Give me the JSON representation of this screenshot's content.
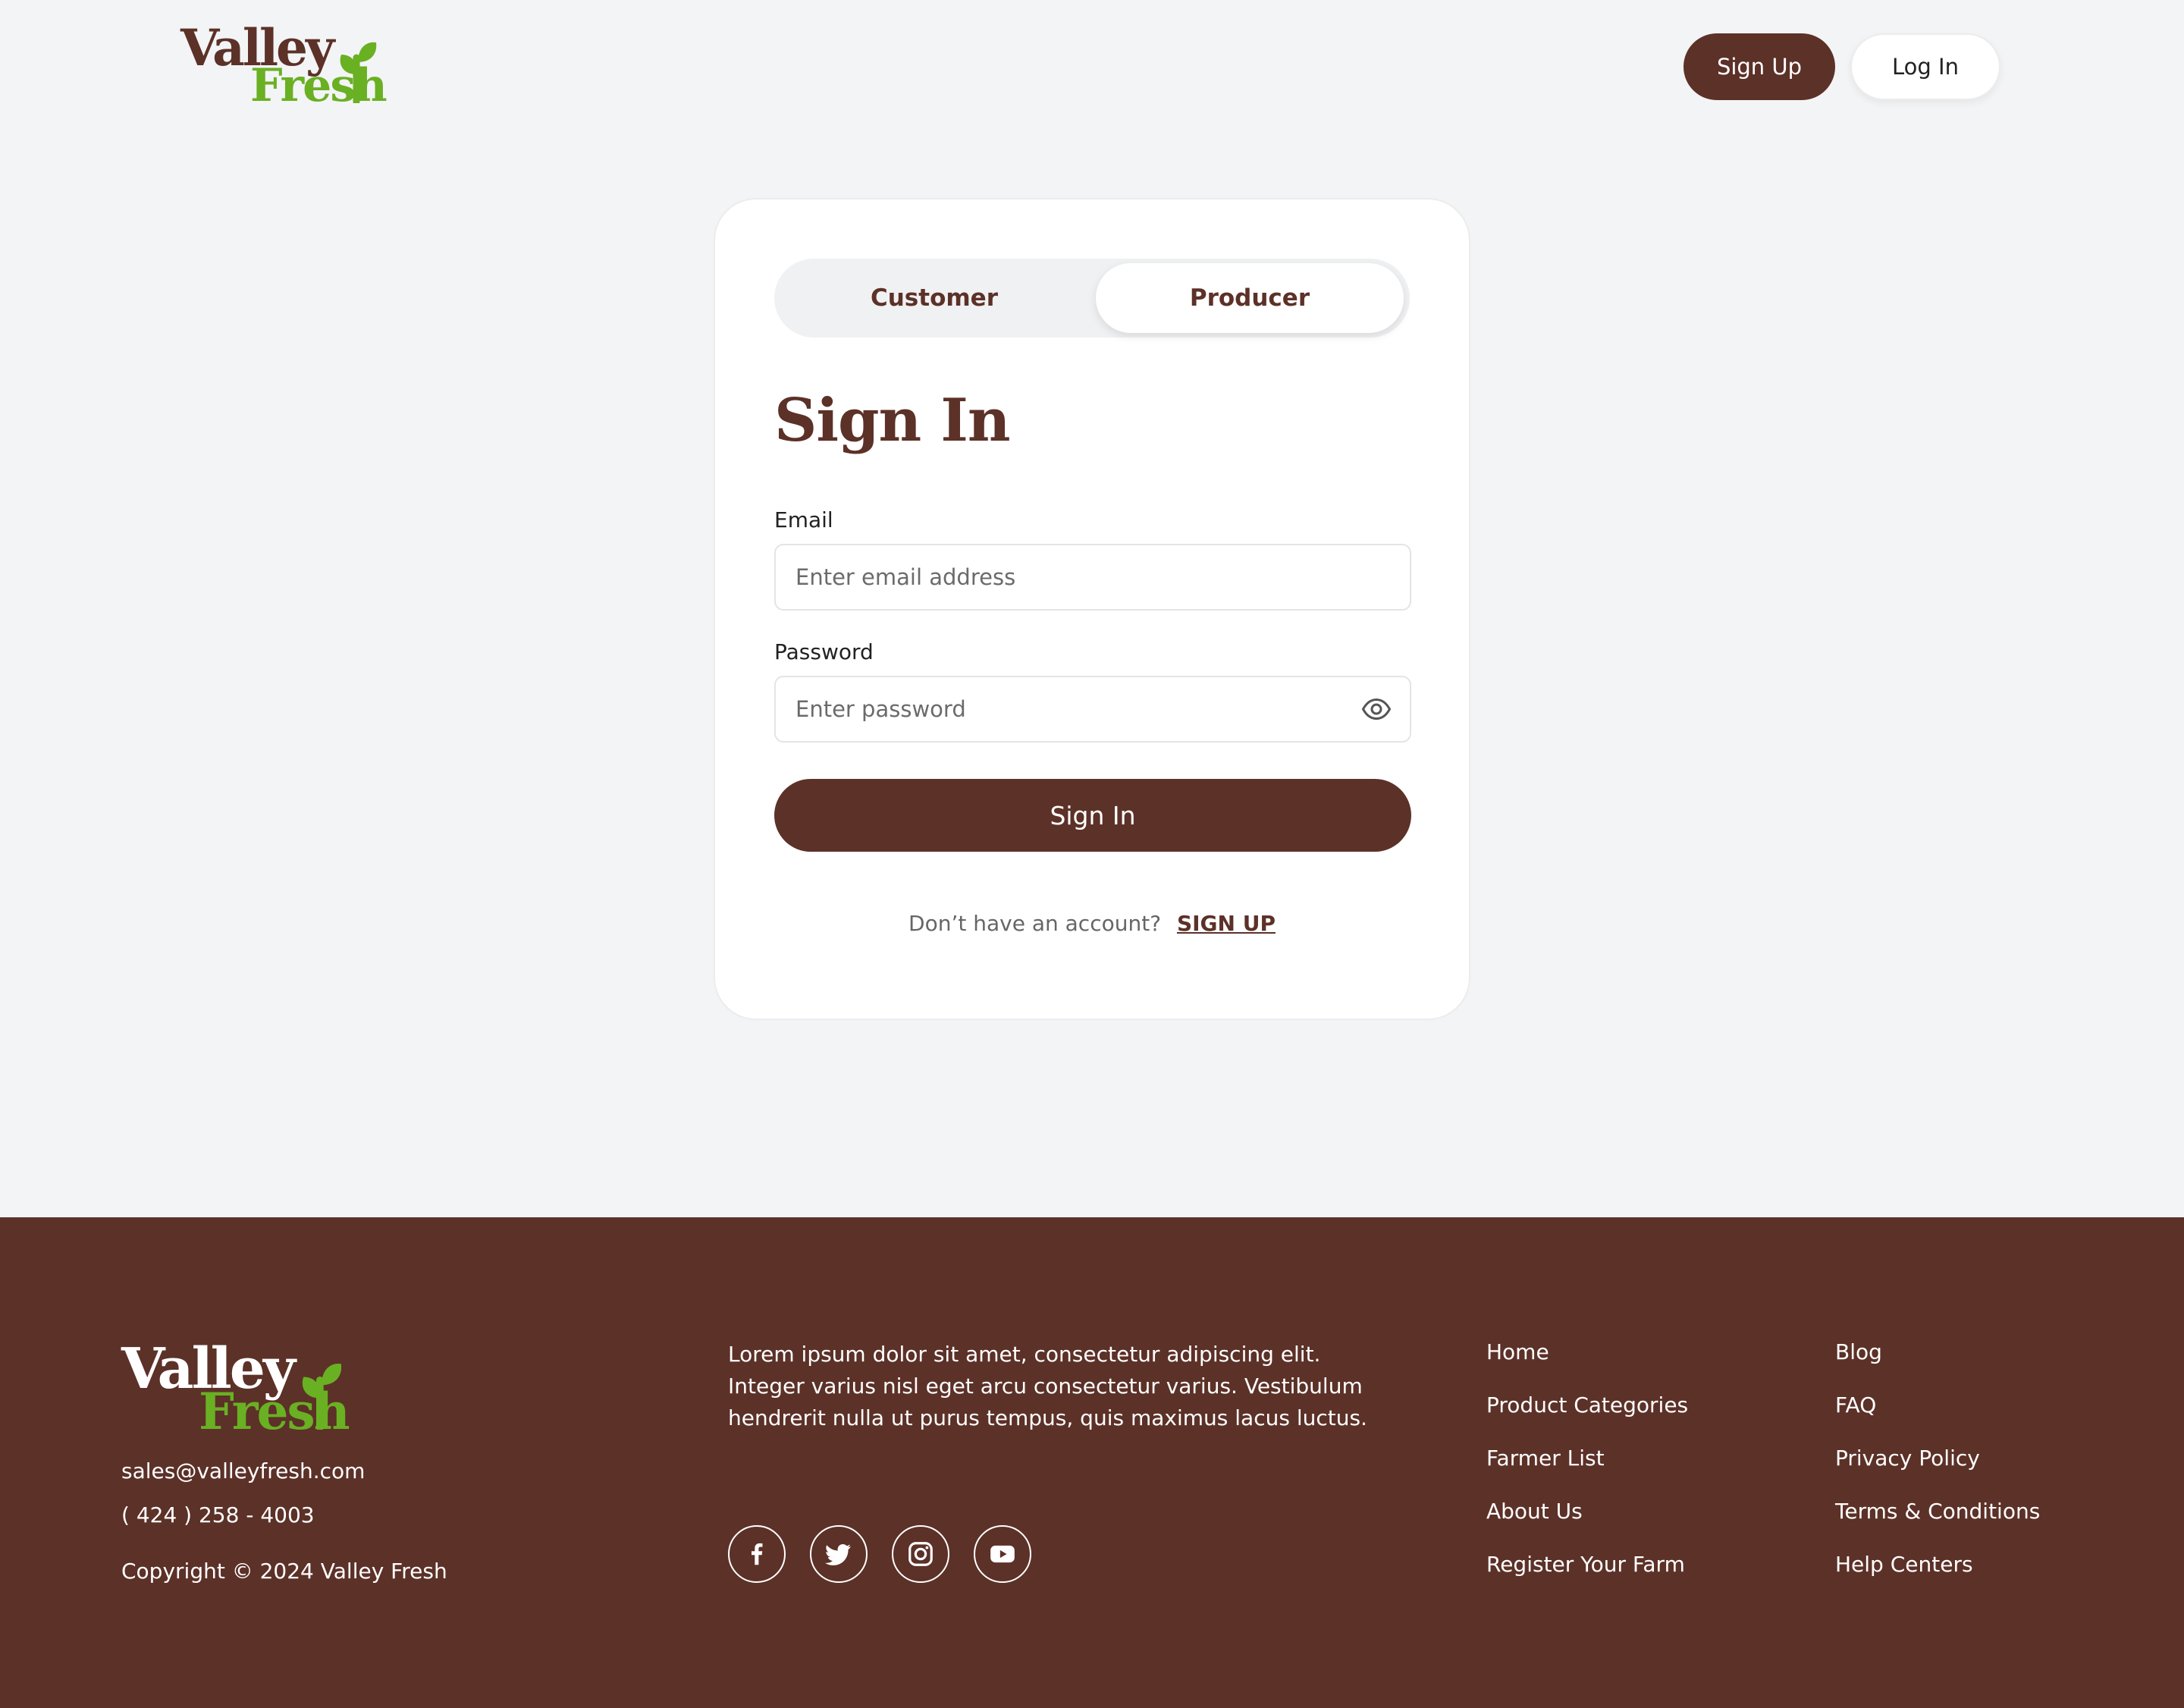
{
  "colors": {
    "brand_brown": "#5c3128",
    "brand_green": "#6ab023",
    "page_bg": "#f3f4f6",
    "card_bg": "#ffffff"
  },
  "logo": {
    "line1": "Valley",
    "line2": "Fresh",
    "icon": "sprout-icon"
  },
  "header": {
    "signup_label": "Sign Up",
    "login_label": "Log In"
  },
  "auth": {
    "tabs": [
      {
        "label": "Customer",
        "active": false
      },
      {
        "label": "Producer",
        "active": true
      }
    ],
    "title": "Sign In",
    "email_label": "Email",
    "email_placeholder": "Enter email address",
    "email_value": "",
    "password_label": "Password",
    "password_placeholder": "Enter password",
    "password_value": "",
    "password_icon": "eye-icon",
    "submit_label": "Sign In",
    "no_account_text": "Don’t have an account?",
    "signup_link": "SIGN UP"
  },
  "footer": {
    "email": "sales@valleyfresh.com",
    "phone": "( 424 ) 258 - 4003",
    "copyright": "Copyright © 2024 Valley Fresh",
    "description": "Lorem ipsum dolor sit amet, consectetur adipiscing elit. Integer varius nisl eget arcu consectetur varius. Vestibulum hendrerit nulla ut purus tempus, quis maximus lacus luctus.",
    "social": [
      "facebook-icon",
      "twitter-icon",
      "instagram-icon",
      "youtube-icon"
    ],
    "links_col1": [
      "Home",
      "Product Categories",
      "Farmer List",
      "About Us",
      "Register Your Farm"
    ],
    "links_col2": [
      "Blog",
      "FAQ",
      "Privacy Policy",
      "Terms & Conditions",
      "Help Centers"
    ]
  }
}
